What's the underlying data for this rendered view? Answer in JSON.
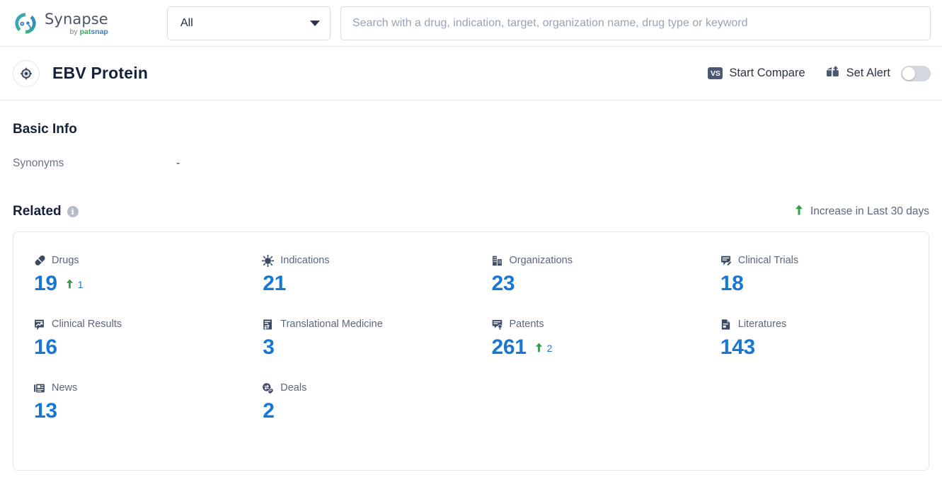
{
  "brand": {
    "name": "Synapse",
    "by": "by ",
    "pat": "pat",
    "snap": "snap",
    "logo_icon": "synapse-circular-logo",
    "colors": {
      "pat_green": "#3aaa5c",
      "snap_blue": "#2f7fd4",
      "name_gray": "#4a5568"
    }
  },
  "search": {
    "scope_value": "All",
    "scope_icon": "chevron-down-icon",
    "placeholder": "Search with a drug, indication, target, organization name, drug type or keyword",
    "value": ""
  },
  "entity": {
    "icon": "target-crosshair-icon",
    "title": "EBV Protein"
  },
  "header_actions": {
    "compare": {
      "label": "Start Compare",
      "icon": "vs-badge-icon",
      "badge_text": "VS"
    },
    "alert": {
      "label": "Set Alert",
      "icon": "alert-envelope-icon",
      "toggle_on": false
    }
  },
  "basic_info": {
    "title": "Basic Info",
    "rows": [
      {
        "key": "Synonyms",
        "value": "-"
      }
    ]
  },
  "related": {
    "title": "Related",
    "info_icon": "info-icon",
    "info_glyph": "i",
    "legend": {
      "icon": "arrow-up-icon",
      "text": "Increase in Last 30 days",
      "color": "#2f9e44"
    },
    "stats": [
      {
        "label": "Drugs",
        "icon": "pill-icon",
        "value": "19",
        "delta": "1"
      },
      {
        "label": "Indications",
        "icon": "virus-icon",
        "value": "21",
        "delta": ""
      },
      {
        "label": "Organizations",
        "icon": "building-icon",
        "value": "23",
        "delta": ""
      },
      {
        "label": "Clinical Trials",
        "icon": "document-pen-icon",
        "value": "18",
        "delta": ""
      },
      {
        "label": "Clinical Results",
        "icon": "document-chart-icon",
        "value": "16",
        "delta": ""
      },
      {
        "label": "Translational Medicine",
        "icon": "document-exchange-icon",
        "value": "3",
        "delta": ""
      },
      {
        "label": "Patents",
        "icon": "certificate-seal-icon",
        "value": "261",
        "delta": "2"
      },
      {
        "label": "Literatures",
        "icon": "file-page-icon",
        "value": "143",
        "delta": ""
      },
      {
        "label": "News",
        "icon": "newspaper-icon",
        "value": "13",
        "delta": ""
      },
      {
        "label": "Deals",
        "icon": "deal-exchange-icon",
        "value": "2",
        "delta": ""
      }
    ]
  },
  "theme": {
    "value_blue": "#1977d4",
    "increase_green": "#2f9e44",
    "icon_navy": "#3d4a63",
    "label_gray": "#5b677c"
  }
}
